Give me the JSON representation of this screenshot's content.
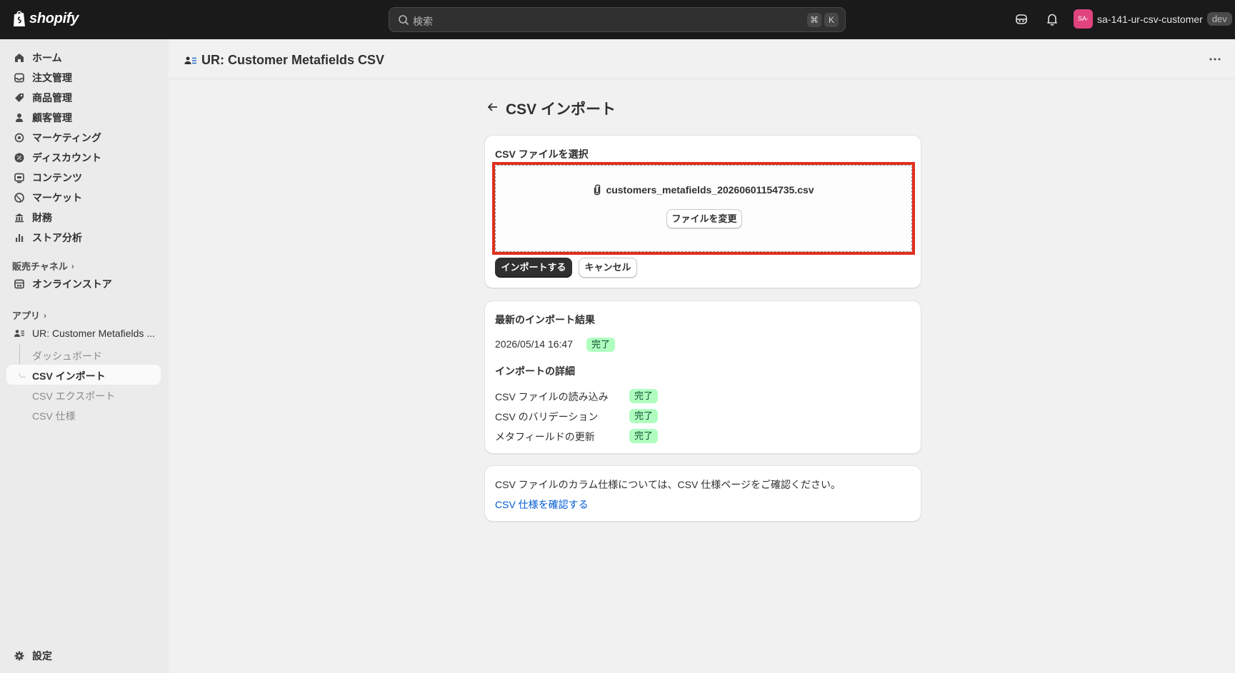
{
  "topbar": {
    "logo_text": "shopify",
    "search_placeholder": "検索",
    "shortcut_key1": "⌘",
    "shortcut_key2": "K",
    "store_avatar": "SA-",
    "store_name": "sa-141-ur-csv-customer",
    "store_badge": "dev"
  },
  "sidebar": {
    "items": [
      {
        "label": "ホーム",
        "icon": "home-icon"
      },
      {
        "label": "注文管理",
        "icon": "inbox-icon"
      },
      {
        "label": "商品管理",
        "icon": "tag-icon"
      },
      {
        "label": "顧客管理",
        "icon": "person-icon"
      },
      {
        "label": "マーケティング",
        "icon": "target-icon"
      },
      {
        "label": "ディスカウント",
        "icon": "discount-icon"
      },
      {
        "label": "コンテンツ",
        "icon": "content-icon"
      },
      {
        "label": "マーケット",
        "icon": "globe-icon"
      },
      {
        "label": "財務",
        "icon": "bank-icon"
      },
      {
        "label": "ストア分析",
        "icon": "chart-icon"
      }
    ],
    "sales_channels_title": "販売チャネル",
    "online_store": "オンラインストア",
    "apps_title": "アプリ",
    "app_name": "UR: Customer Metafields ...",
    "app_sub_items": [
      "ダッシュボード",
      "CSV インポート",
      "CSV エクスポート",
      "CSV 仕様"
    ],
    "settings": "設定"
  },
  "header": {
    "app_title": "UR: Customer Metafields CSV"
  },
  "page": {
    "title": "CSV インポート",
    "select_card": {
      "heading": "CSV ファイルを選択",
      "file_name": "customers_metafields_20260601154735.csv",
      "change_button": "ファイルを変更",
      "import_button": "インポートする",
      "cancel_button": "キャンセル"
    },
    "result_card": {
      "heading": "最新のインポート結果",
      "timestamp": "2026/05/14 16:47",
      "status": "完了",
      "details_heading": "インポートの詳細",
      "details": [
        {
          "label": "CSV ファイルの読み込み",
          "status": "完了"
        },
        {
          "label": "CSV のバリデーション",
          "status": "完了"
        },
        {
          "label": "メタフィールドの更新",
          "status": "完了"
        }
      ]
    },
    "info_card": {
      "text": "CSV ファイルのカラム仕様については、CSV 仕様ページをご確認ください。",
      "link": "CSV 仕様を確認する"
    }
  },
  "colors": {
    "highlight": "#e0301e",
    "badge_success_bg": "#affebf",
    "link": "#005bd3"
  }
}
